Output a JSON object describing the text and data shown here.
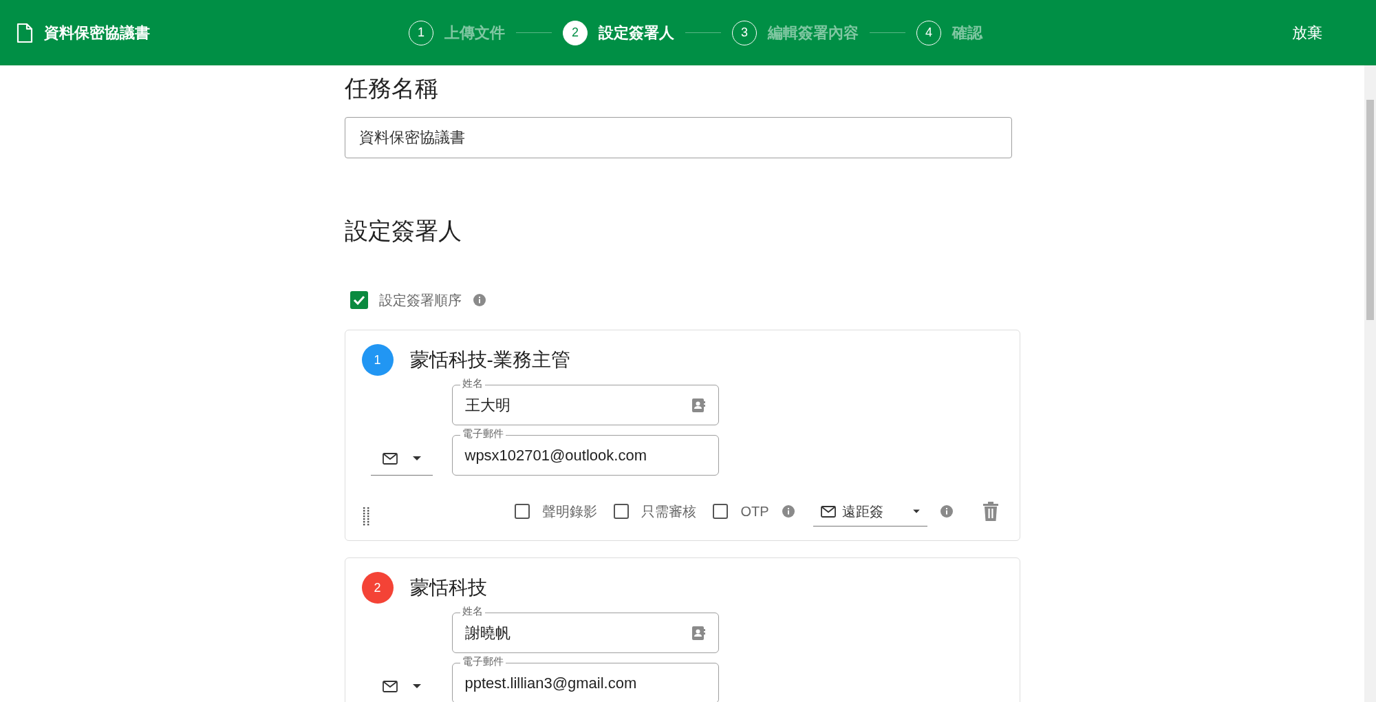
{
  "header": {
    "document_title": "資料保密協議書",
    "steps": [
      {
        "number": "1",
        "label": "上傳文件",
        "selected": false
      },
      {
        "number": "2",
        "label": "設定簽署人",
        "selected": true
      },
      {
        "number": "3",
        "label": "編輯簽署內容",
        "selected": false
      },
      {
        "number": "4",
        "label": "確認",
        "selected": false
      }
    ],
    "discard": "放棄"
  },
  "task_name": {
    "heading": "任務名稱",
    "value": "資料保密協議書"
  },
  "signers_section": {
    "heading": "設定簽署人",
    "signing_order": {
      "label": "設定簽署順序",
      "checked": true
    }
  },
  "signers": [
    {
      "number": "1",
      "color": "#2196f3",
      "role": "蒙恬科技-業務主管",
      "name": {
        "label": "姓名",
        "value": "王大明"
      },
      "email": {
        "label": "電子郵件",
        "value": "wpsx102701@outlook.com"
      },
      "options": [
        {
          "label": "聲明錄影",
          "checked": false
        },
        {
          "label": "只需審核",
          "checked": false
        },
        {
          "label": "OTP",
          "checked": false,
          "info": true
        }
      ],
      "signing_method": "遠距簽"
    },
    {
      "number": "2",
      "color": "#f44336",
      "role": "蒙恬科技",
      "name": {
        "label": "姓名",
        "value": "謝曉帆"
      },
      "email": {
        "label": "電子郵件",
        "value": "pptest.lillian3@gmail.com"
      }
    }
  ]
}
